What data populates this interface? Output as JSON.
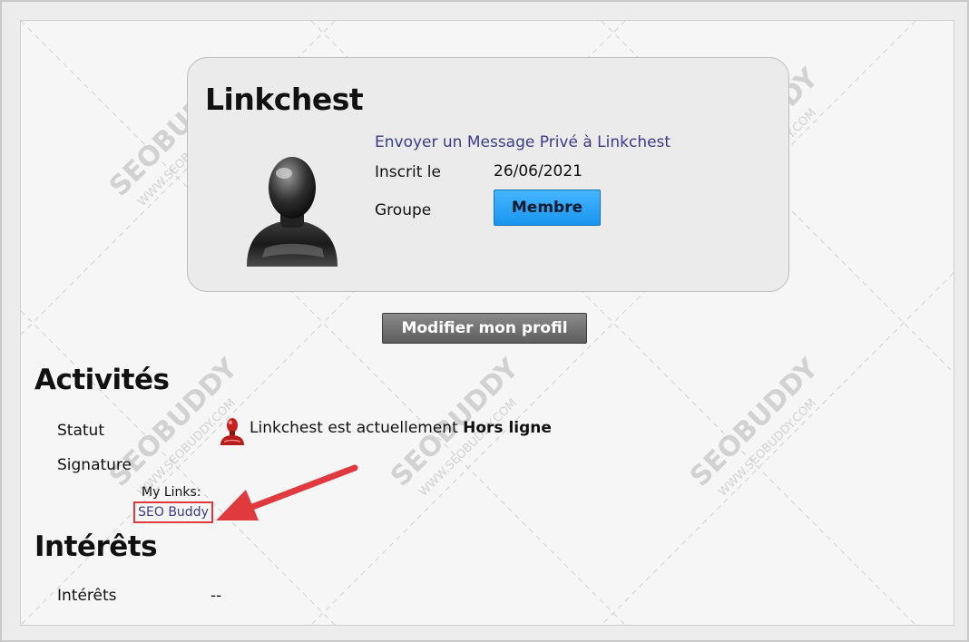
{
  "profile": {
    "username": "Linkchest",
    "pm_link": "Envoyer un Message Privé à Linkchest",
    "registered_label": "Inscrit le",
    "registered_value": "26/06/2021",
    "group_label": "Groupe",
    "group_value": "Membre"
  },
  "edit_profile_button": "Modifier mon profil",
  "activities": {
    "title": "Activités",
    "status_label": "Statut",
    "status_prefix": "Linkchest est actuellement",
    "status_value": "Hors ligne",
    "signature_label": "Signature",
    "signature_heading": "My Links:",
    "signature_link": "SEO Buddy"
  },
  "interests": {
    "title": "Intérêts",
    "label": "Intérêts",
    "value": "--"
  },
  "watermark": {
    "text": "SEOBUDDY",
    "subtext": "WWW.SEOBUDDY.COM"
  },
  "colors": {
    "link": "#3b3b8a",
    "group_button": "#1a96f0",
    "edit_button": "#5e5e5e",
    "highlight": "#e0393e"
  }
}
